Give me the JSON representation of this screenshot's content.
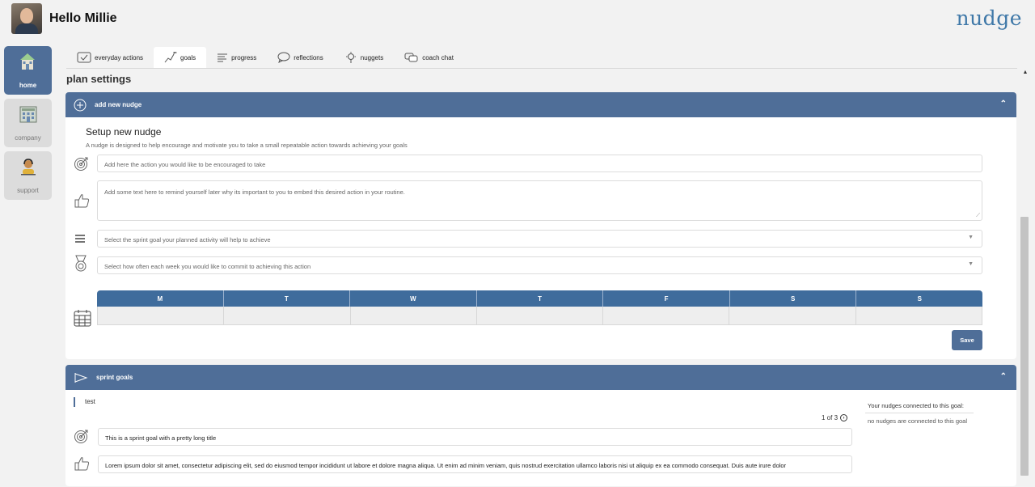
{
  "header": {
    "greeting": "Hello Millie",
    "logo": "nudge"
  },
  "leftnav": {
    "items": [
      {
        "label": "home",
        "icon": "house-icon",
        "active": true
      },
      {
        "label": "company",
        "icon": "building-icon",
        "active": false
      },
      {
        "label": "support",
        "icon": "support-person-icon",
        "active": false
      }
    ]
  },
  "tabs": [
    {
      "label": "everyday actions",
      "icon": "calendar-check-icon"
    },
    {
      "label": "goals",
      "icon": "goal-flag-icon",
      "active": true
    },
    {
      "label": "progress",
      "icon": "progress-bars-icon"
    },
    {
      "label": "reflections",
      "icon": "speech-bubble-icon"
    },
    {
      "label": "nuggets",
      "icon": "lightbulb-icon"
    },
    {
      "label": "coach chat",
      "icon": "chat-bubbles-icon"
    }
  ],
  "page": {
    "title": "plan settings"
  },
  "add_nudge": {
    "header": "add new nudge",
    "setup_title": "Setup new nudge",
    "setup_sub": "A nudge is designed to help encourage and motivate you to take a small repeatable action towards achieving your goals",
    "action_placeholder": "Add here the action you would like to be encouraged to take",
    "reason_placeholder": "Add some text here to remind yourself later why its important to you to embed this desired action in your routine.",
    "sprint_select_placeholder": "Select the sprint goal your planned activity will help to achieve",
    "frequency_select_placeholder": "Select how often each week you would like to commit to achieving this action",
    "days": [
      "M",
      "T",
      "W",
      "T",
      "F",
      "S",
      "S"
    ],
    "save_label": "Save"
  },
  "sprint_goals": {
    "header": "sprint goals",
    "goal_name": "test",
    "pager": "1 of 3",
    "connected_title": "Your nudges connected to this goal:",
    "connected_none": "no nudges are connected to this goal",
    "goal_title": "This is a sprint goal with a pretty long title",
    "goal_description": "Lorem ipsum dolor sit amet, consectetur adipiscing elit, sed do eiusmod tempor incididunt ut labore et dolore magna aliqua. Ut enim ad minim veniam, quis nostrud exercitation ullamco laboris nisi ut aliquip ex ea commodo consequat. Duis aute irure dolor"
  },
  "colors": {
    "accent": "#4f6e98",
    "week_header": "#3f6c9c",
    "logo": "#3f78a8"
  }
}
